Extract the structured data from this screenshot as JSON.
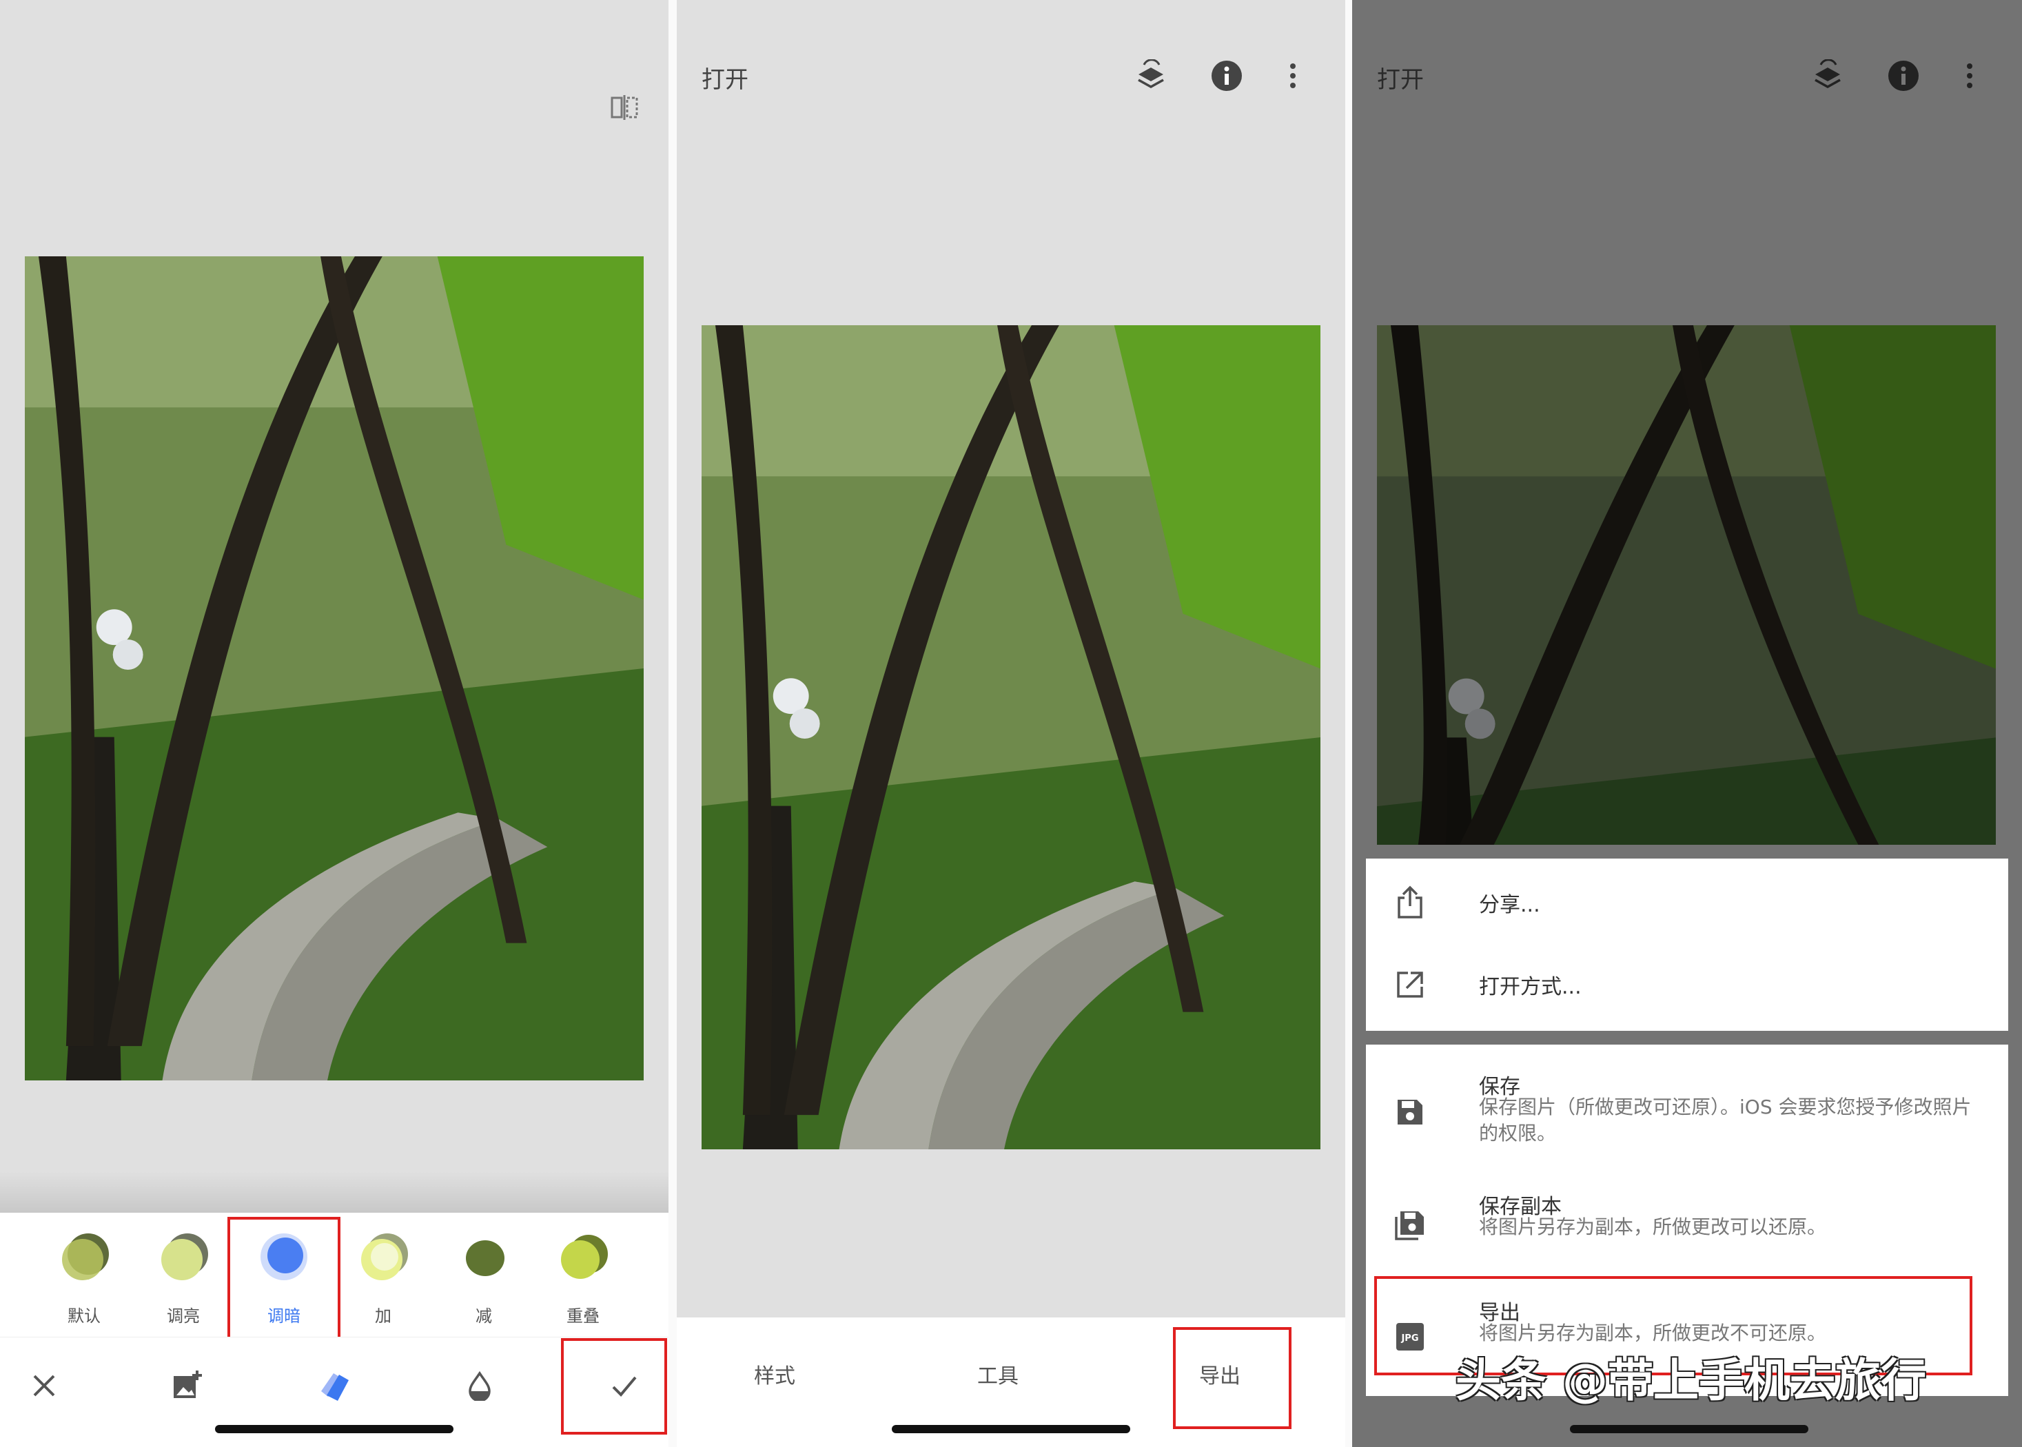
{
  "panel1": {
    "blend_modes": [
      {
        "label": "默认",
        "colors": [
          "#8c9a5a",
          "#b7c35e"
        ]
      },
      {
        "label": "调亮",
        "colors": [
          "#9aa37a",
          "#d7e28c"
        ]
      },
      {
        "label": "调暗",
        "colors": [
          "#9fb6f7",
          "#4a7ef2"
        ],
        "selected": true
      },
      {
        "label": "加",
        "colors": [
          "#b9c27f",
          "#eef4b0"
        ]
      },
      {
        "label": "减",
        "colors": [
          "#5f7431",
          "#5f7431"
        ]
      },
      {
        "label": "重叠",
        "colors": [
          "#6b7d2c",
          "#c4d64a"
        ]
      }
    ],
    "selected_color": "#3c78f0",
    "tools": [
      "close-icon",
      "add-image-icon",
      "styles-icon",
      "opacity-icon",
      "check-icon"
    ]
  },
  "panel2": {
    "title": "打开",
    "tabs": [
      "样式",
      "工具",
      "导出"
    ]
  },
  "panel3": {
    "title": "打开",
    "share_items": [
      {
        "icon": "share-icon",
        "title": "分享..."
      },
      {
        "icon": "open-with-icon",
        "title": "打开方式..."
      }
    ],
    "save_items": [
      {
        "icon": "save-icon",
        "title": "保存",
        "subtitle": "保存图片（所做更改可还原）。iOS 会要求您授予修改照片的权限。"
      },
      {
        "icon": "save-copy-icon",
        "title": "保存副本",
        "subtitle": "将图片另存为副本，所做更改可以还原。"
      },
      {
        "icon": "jpg-icon",
        "title": "导出",
        "subtitle": "将图片另存为副本，所做更改不可还原。",
        "badge": "JPG"
      }
    ]
  },
  "watermark": "头条 @带上手机去旅行",
  "colors": {
    "highlight_box": "#e02020",
    "accent_blue": "#3c78f0"
  }
}
